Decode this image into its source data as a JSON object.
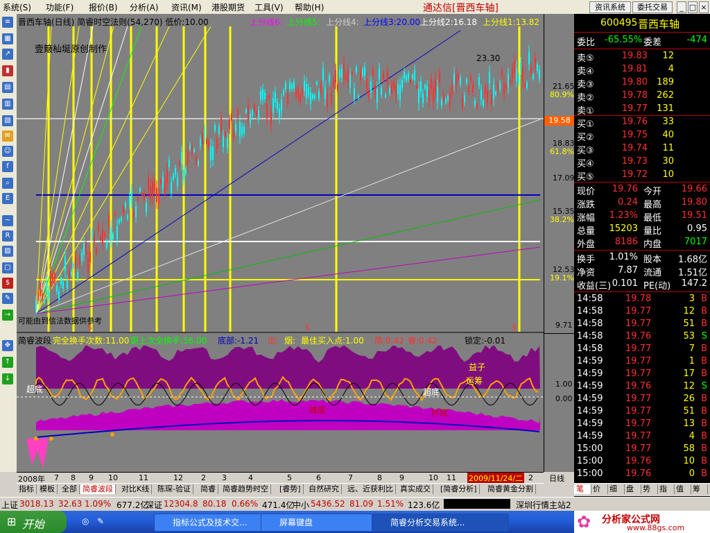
{
  "menu": {
    "items": [
      "系统(S)",
      "功能(F)",
      "报价(B)",
      "分析(A)",
      "资讯(M)",
      "港股期货",
      "工具(V)",
      "帮助(H)"
    ],
    "app_title": "通达信[晋西车轴]",
    "buttons": [
      "资讯系统",
      "委托交易"
    ]
  },
  "chart": {
    "header": "晋西车轴(日线) 简睿时空法则(54,270) 低价:10.00",
    "fan_labels": [
      "上分线6:",
      "上分线5:",
      "上分线4:",
      "上分线3:20.00",
      "上分线2:16.18",
      "上分线1:13.82"
    ],
    "watermark": "壹簸杣埏原创制作",
    "peak_label": "23.30",
    "footer_note": "可能由到信法数据供参考",
    "price_ticks": [
      "21.65",
      "80.9%",
      "18.83",
      "61.8%",
      "17.09",
      "15.35",
      "38.2%",
      "12.53",
      "19.1%",
      "9.71"
    ],
    "current_price_tag": "19.58",
    "indicator_header": {
      "name": "简睿波段",
      "items": [
        "完全换手次数:11.00",
        "距上次全换手:56.00",
        "底部:-1.21",
        "出:",
        "烟:",
        "最佳买入点:1.00",
        "简:0.42",
        "睿:0.42",
        "锁定:-0.01"
      ]
    },
    "indicator_ticks": [
      "1.00",
      "0.00"
    ],
    "indicator_labels": [
      "超底",
      "运筹",
      "益子",
      "超底",
      "峰底",
      "抄底"
    ],
    "dollar_marks": [
      "$",
      "$",
      "$"
    ],
    "time_axis": [
      "2008年",
      "7",
      "8",
      "9",
      "10",
      "11",
      "12",
      "2",
      "3",
      "4",
      "5",
      "6",
      "7",
      "8",
      "9",
      "10",
      "11",
      "2009/11/24/二",
      "2"
    ],
    "period_label": "日线",
    "bottom_tabs": [
      "指标",
      "模板",
      "全部",
      "简睿波段",
      "对比K线",
      "陈琛-验证",
      "简睿",
      "简睿趋势时空",
      "[睿势]",
      "自然研究",
      "远、近获利比",
      "真实成交",
      "[简睿分析]",
      "简睿黄金分割"
    ]
  },
  "quote": {
    "code": "600495",
    "name": "晋西车轴",
    "weibi_label": "委比",
    "weibi": "-65.55%",
    "weicha_label": "委差",
    "weicha": "-474",
    "asks": [
      {
        "label": "卖⑤",
        "price": "19.83",
        "vol": "12"
      },
      {
        "label": "卖④",
        "price": "19.81",
        "vol": "4"
      },
      {
        "label": "卖③",
        "price": "19.80",
        "vol": "189"
      },
      {
        "label": "卖②",
        "price": "19.78",
        "vol": "262"
      },
      {
        "label": "卖①",
        "price": "19.77",
        "vol": "131"
      }
    ],
    "bids": [
      {
        "label": "买①",
        "price": "19.76",
        "vol": "33"
      },
      {
        "label": "买②",
        "price": "19.75",
        "vol": "40"
      },
      {
        "label": "买③",
        "price": "19.74",
        "vol": "11"
      },
      {
        "label": "买④",
        "price": "19.73",
        "vol": "30"
      },
      {
        "label": "买⑤",
        "price": "19.72",
        "vol": "10"
      }
    ],
    "stats": [
      {
        "l1": "现价",
        "v1": "19.76",
        "c1": "red",
        "l2": "今开",
        "v2": "19.66",
        "c2": "red"
      },
      {
        "l1": "涨跌",
        "v1": "0.24",
        "c1": "red",
        "l2": "最高",
        "v2": "19.80",
        "c2": "red"
      },
      {
        "l1": "涨幅",
        "v1": "1.23%",
        "c1": "red",
        "l2": "最低",
        "v2": "19.51",
        "c2": "red"
      },
      {
        "l1": "总量",
        "v1": "15203",
        "c1": "yel",
        "l2": "量比",
        "v2": "0.95",
        "c2": "wht"
      },
      {
        "l1": "外盘",
        "v1": "8186",
        "c1": "red",
        "l2": "内盘",
        "v2": "7017",
        "c2": "grn"
      }
    ],
    "stats2": [
      {
        "l1": "换手",
        "v1": "1.01%",
        "l2": "股本",
        "v2": "1.68亿"
      },
      {
        "l1": "净资",
        "v1": "7.87",
        "l2": "流通",
        "v2": "1.51亿"
      },
      {
        "l1": "收益(三)",
        "v1": "0.101",
        "l2": "PE(动)",
        "v2": "147.2"
      }
    ],
    "ticks": [
      {
        "t": "14:58",
        "p": "19.78",
        "v": "3",
        "s": "B"
      },
      {
        "t": "14:58",
        "p": "19.77",
        "v": "12",
        "s": "B"
      },
      {
        "t": "14:58",
        "p": "19.77",
        "v": "51",
        "s": "B"
      },
      {
        "t": "14:58",
        "p": "19.76",
        "v": "53",
        "s": "S"
      },
      {
        "t": "14:58",
        "p": "19.77",
        "v": "7",
        "s": "B"
      },
      {
        "t": "14:59",
        "p": "19.77",
        "v": "1",
        "s": "B"
      },
      {
        "t": "14:59",
        "p": "19.77",
        "v": "17",
        "s": "B"
      },
      {
        "t": "14:59",
        "p": "19.76",
        "v": "12",
        "s": "S"
      },
      {
        "t": "14:59",
        "p": "19.77",
        "v": "26",
        "s": "B"
      },
      {
        "t": "14:59",
        "p": "19.77",
        "v": "51",
        "s": "B"
      },
      {
        "t": "14:59",
        "p": "19.77",
        "v": "13",
        "s": "B"
      },
      {
        "t": "14:59",
        "p": "19.77",
        "v": "4",
        "s": "B"
      },
      {
        "t": "15:00",
        "p": "19.77",
        "v": "58",
        "s": "B"
      },
      {
        "t": "15:00",
        "p": "19.76",
        "v": "10",
        "s": "B"
      },
      {
        "t": "15:00",
        "p": "19.76",
        "v": "0",
        "s": "B"
      }
    ],
    "tabs": [
      "笔",
      "价",
      "细",
      "盘",
      "势",
      "指",
      "值",
      "筹"
    ]
  },
  "status": {
    "sh_label": "上证",
    "sh_value": "3018.13",
    "sh_change": "32.63",
    "sh_pct": "1.09%",
    "sh_amount": "677.2亿",
    "sz_label": "深证",
    "sz_value": "12304.8",
    "sz_change": "80.18",
    "sz_pct": "0.66%",
    "sz_amount": "471.4亿",
    "zx_label": "中小",
    "zx_value": "5436.52",
    "zx_change": "81.09",
    "zx_pct": "1.51%",
    "zx_amount": "123.6亿",
    "server": "深圳行情主站2"
  },
  "taskbar": {
    "start": "开始",
    "tasks": [
      "指标公式及技术交...",
      "屏幕键盘",
      "简睿分析交易系统..."
    ],
    "logo": "分析家公式网",
    "logo_url": "www.88gs.com"
  },
  "colors": {
    "up": "#ff3030",
    "down": "#00ffff",
    "yellow": "#ffff00",
    "blue": "#0000c0",
    "white": "#ffffff",
    "magenta": "#b000b0"
  }
}
